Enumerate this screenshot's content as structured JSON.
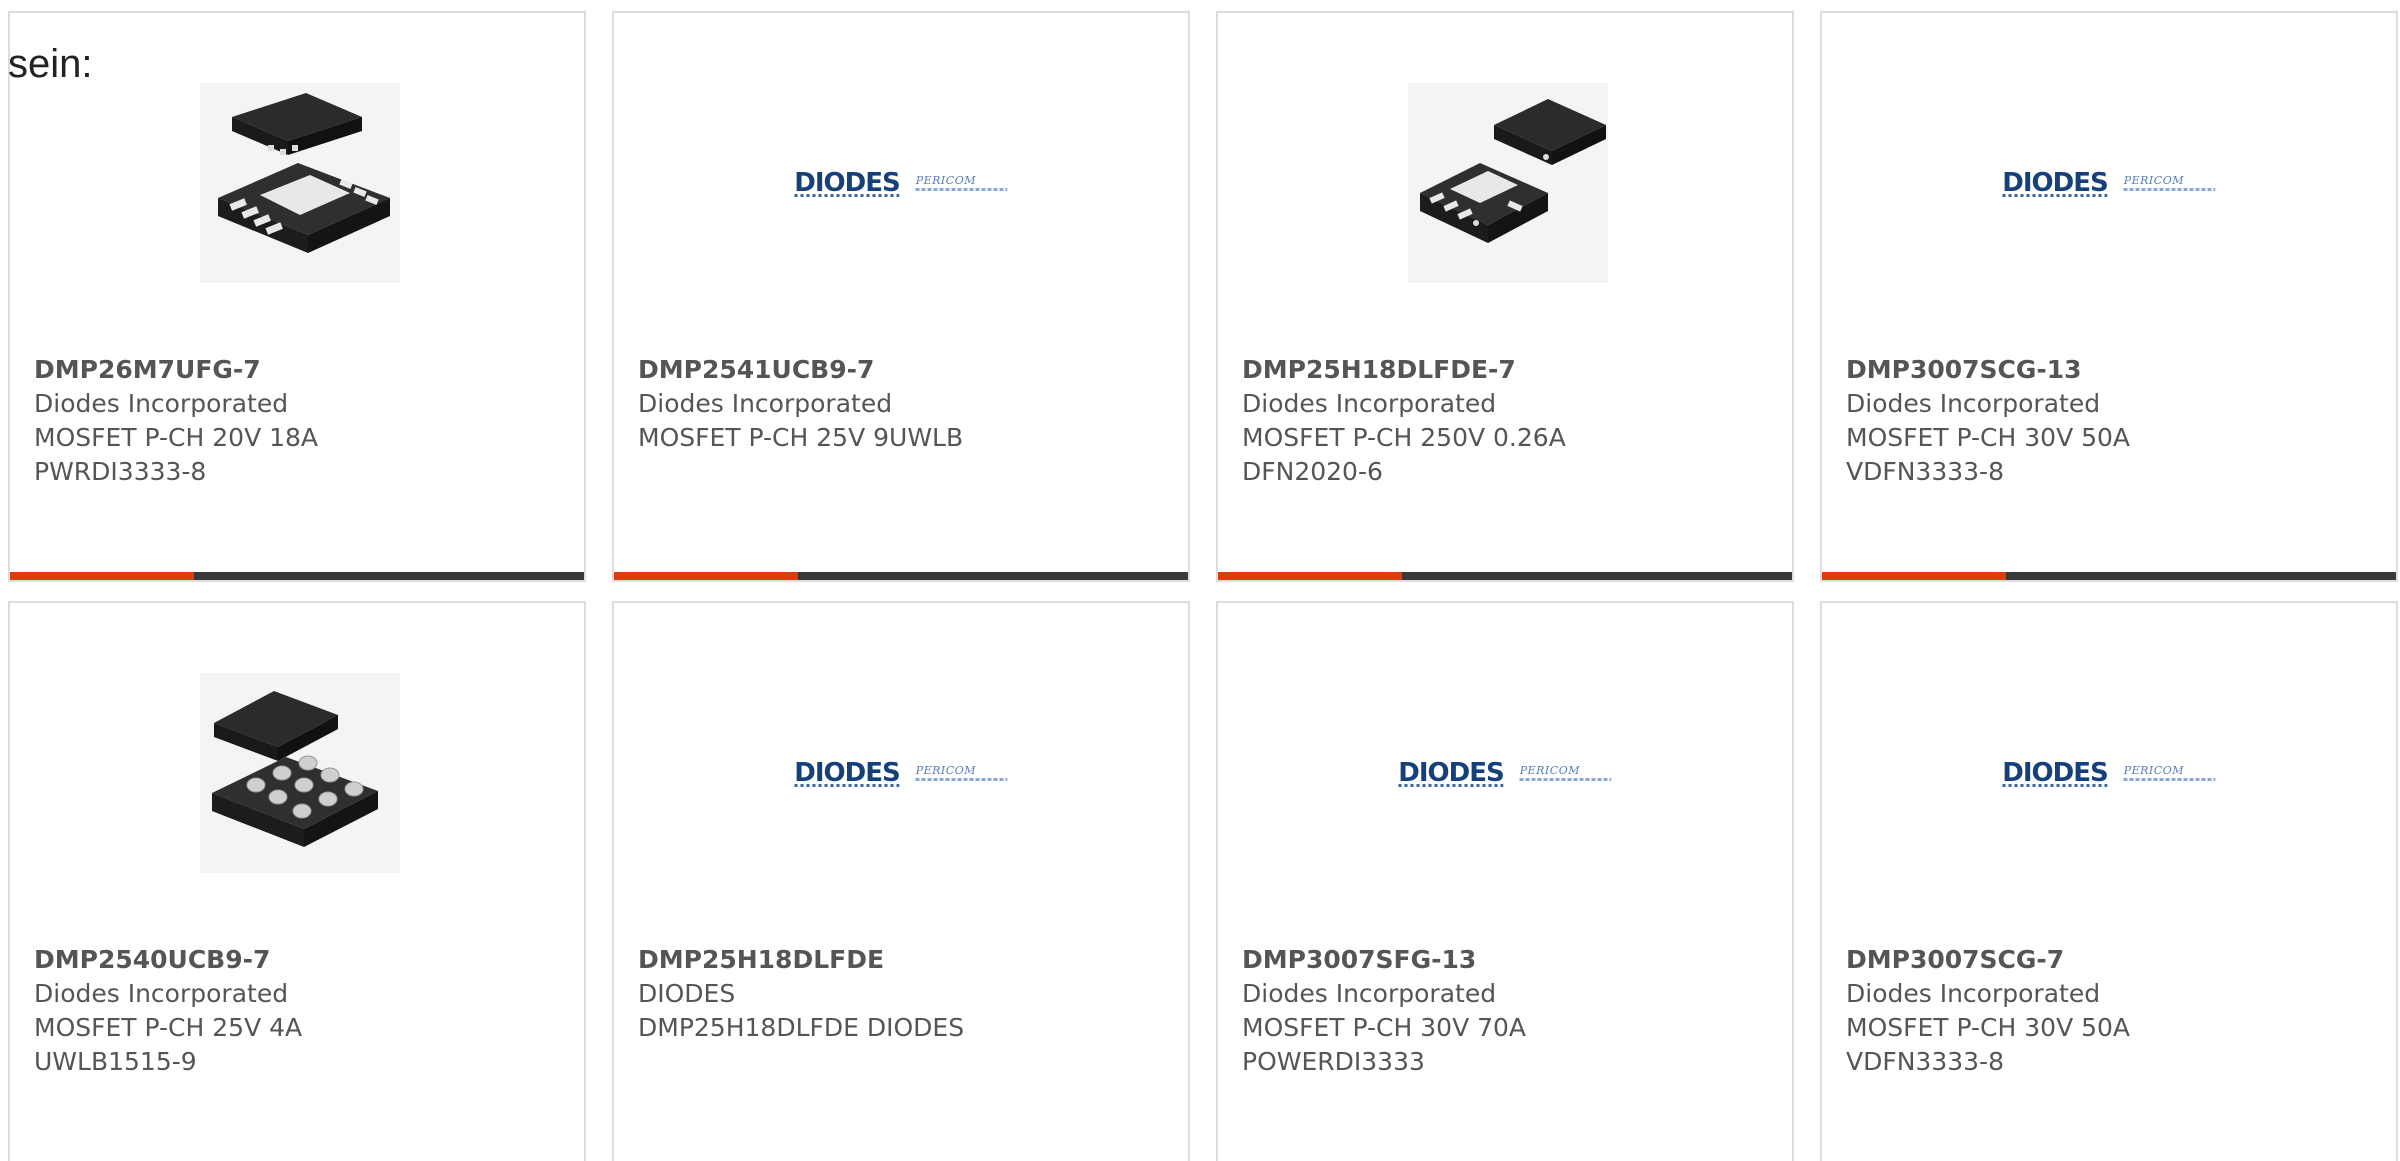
{
  "intro_text": "sein:",
  "colors": {
    "progress_fill": "#dd3c0b",
    "progress_track": "#3a3a3a",
    "logo_blue": "#16407a"
  },
  "logo": {
    "brand": "DIODES",
    "secondary": "PERICOM"
  },
  "carousel_progress": 0.32,
  "products": [
    {
      "part_number": "DMP26M7UFG-7",
      "manufacturer": "Diodes Incorporated",
      "description": "MOSFET P-CH 20V 18A",
      "package": "PWRDI3333-8",
      "image": "chip-package-8pad-icon"
    },
    {
      "part_number": "DMP2541UCB9-7",
      "manufacturer": "Diodes Incorporated",
      "description": "MOSFET P-CH 25V 9UWLB",
      "package": "",
      "image": "diodes-pericom-logo"
    },
    {
      "part_number": "DMP25H18DLFDE-7",
      "manufacturer": "Diodes Incorporated",
      "description": "MOSFET P-CH 250V 0.26A",
      "package": "DFN2020-6",
      "image": "chip-package-6pad-icon"
    },
    {
      "part_number": "DMP3007SCG-13",
      "manufacturer": "Diodes Incorporated",
      "description": "MOSFET P-CH 30V 50A",
      "package": "VDFN3333-8",
      "image": "diodes-pericom-logo"
    },
    {
      "part_number": "DMP2540UCB9-7",
      "manufacturer": "Diodes Incorporated",
      "description": "MOSFET P-CH 25V 4A",
      "package": "UWLB1515-9",
      "image": "chip-package-bga-icon"
    },
    {
      "part_number": "DMP25H18DLFDE",
      "manufacturer": "DIODES",
      "description": "DMP25H18DLFDE DIODES",
      "package": "",
      "image": "diodes-pericom-logo"
    },
    {
      "part_number": "DMP3007SFG-13",
      "manufacturer": "Diodes Incorporated",
      "description": "MOSFET P-CH 30V 70A",
      "package": "POWERDI3333",
      "image": "diodes-pericom-logo"
    },
    {
      "part_number": "DMP3007SCG-7",
      "manufacturer": "Diodes Incorporated",
      "description": "MOSFET P-CH 30V 50A",
      "package": "VDFN3333-8",
      "image": "diodes-pericom-logo"
    }
  ]
}
